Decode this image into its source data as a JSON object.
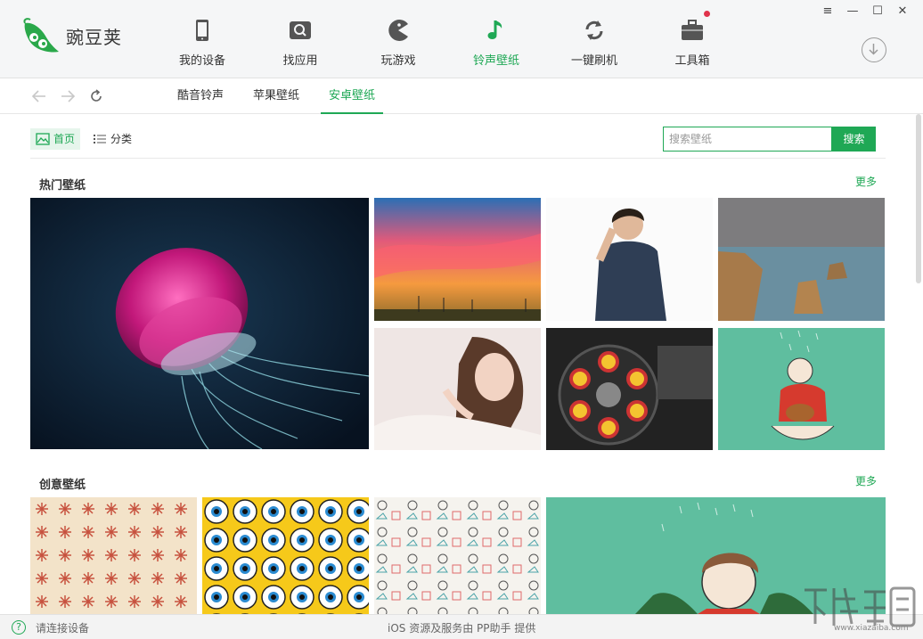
{
  "app": {
    "logo_text": "豌豆荚",
    "brand_color": "#1fa855"
  },
  "nav": {
    "items": [
      {
        "label": "我的设备",
        "icon": "phone-icon"
      },
      {
        "label": "找应用",
        "icon": "app-search-icon"
      },
      {
        "label": "玩游戏",
        "icon": "pacman-icon"
      },
      {
        "label": "铃声壁纸",
        "icon": "music-note-icon"
      },
      {
        "label": "一键刷机",
        "icon": "refresh-icon"
      },
      {
        "label": "工具箱",
        "icon": "toolbox-icon"
      }
    ],
    "active_index": 3
  },
  "window_controls": {
    "menu": "≡",
    "minimize": "—",
    "maximize": "☐",
    "close": "✕"
  },
  "subnav": {
    "tabs": [
      "酷音铃声",
      "苹果壁纸",
      "安卓壁纸"
    ],
    "active_index": 2
  },
  "view": {
    "home_label": "首页",
    "category_label": "分类"
  },
  "search": {
    "placeholder": "搜索壁纸",
    "button_label": "搜索"
  },
  "sections": {
    "hot": {
      "title": "热门壁纸",
      "more": "更多"
    },
    "creative": {
      "title": "创意壁纸",
      "more": "更多"
    }
  },
  "status": {
    "help": "?",
    "left": "请连接设备",
    "center": "iOS 资源及服务由 PP助手 提供"
  },
  "watermark": {
    "sub": "www.xiazaiba.com"
  }
}
